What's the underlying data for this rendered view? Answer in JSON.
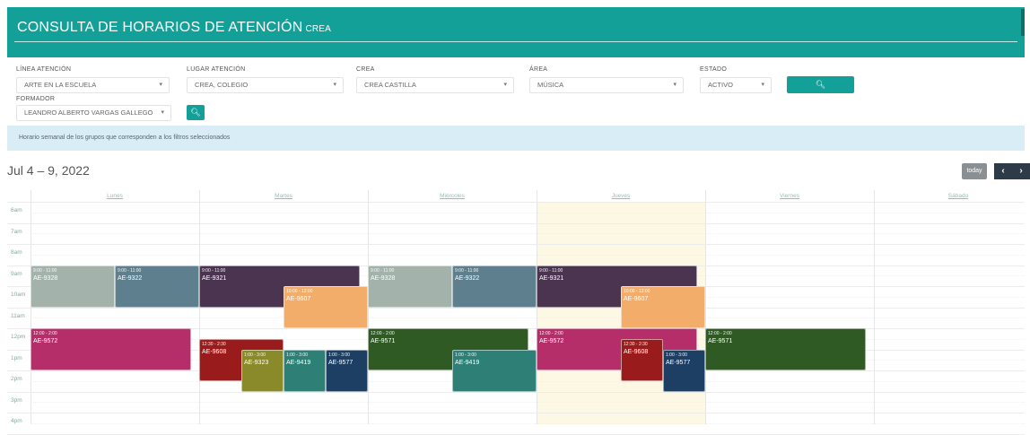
{
  "header": {
    "title": "CONSULTA DE HORARIOS DE ATENCIÓN",
    "suffix": "CREA"
  },
  "filters": {
    "linea": {
      "label": "LÍNEA ATENCIÓN",
      "value": "ARTE EN LA ESCUELA"
    },
    "lugar": {
      "label": "LUGAR ATENCIÓN",
      "value": "CREA, COLEGIO"
    },
    "crea": {
      "label": "CREA",
      "value": "CREA CASTILLA"
    },
    "area": {
      "label": "ÁREA",
      "value": "MÚSICA"
    },
    "estado": {
      "label": "ESTADO",
      "value": "ACTIVO"
    },
    "formador": {
      "label": "FORMADOR",
      "value": "LEANDRO ALBERTO VARGAS GALLEGO"
    },
    "search_icon": "search-icon"
  },
  "info_text": "Horario semanal de los grupos que corresponden a los filtros seleccionados",
  "calendar": {
    "date_range": "Jul 4 – 9, 2022",
    "today_label": "today",
    "prev_label": "‹",
    "next_label": "›",
    "days": [
      "Lunes",
      "Martes",
      "Miércoles",
      "Jueves",
      "Viernes",
      "Sábado"
    ],
    "times": [
      "6am",
      "7am",
      "8am",
      "9am",
      "10am",
      "11am",
      "12pm",
      "1pm",
      "2pm",
      "3pm",
      "4pm"
    ],
    "events": [
      {
        "day": 0,
        "start": 9,
        "end": 11,
        "lane": 0,
        "lanes": 2,
        "time": "9:00 - 11:00",
        "code": "AE-9328",
        "color": "#a3b3ac"
      },
      {
        "day": 0,
        "start": 9,
        "end": 11,
        "lane": 1,
        "lanes": 2,
        "time": "9:00 - 11:00",
        "code": "AE-9322",
        "color": "#5d7f8e"
      },
      {
        "day": 0,
        "start": 12,
        "end": 14,
        "lane": 0,
        "lanes": 1,
        "time": "12:00 - 2:00",
        "code": "AE-9572",
        "color": "#b52e69"
      },
      {
        "day": 1,
        "start": 9,
        "end": 11,
        "lane": 0,
        "lanes": 1,
        "time": "9:00 - 11:00",
        "code": "AE-9321",
        "color": "#4a3450"
      },
      {
        "day": 1,
        "start": 10,
        "end": 12,
        "lane": 1,
        "lanes": 2,
        "time": "10:00 - 12:00",
        "code": "AE-9607",
        "color": "#f2ad6a"
      },
      {
        "day": 1,
        "start": 12.5,
        "end": 14.5,
        "lane": 0,
        "lanes": 2,
        "time": "12:30 - 2:30",
        "code": "AE-9608",
        "color": "#9a1b1b"
      },
      {
        "day": 1,
        "start": 13,
        "end": 15,
        "lane": 1,
        "lanes": 4,
        "time": "1:00 - 3:00",
        "code": "AE-9323",
        "color": "#8a8a2b"
      },
      {
        "day": 1,
        "start": 13,
        "end": 15,
        "lane": 2,
        "lanes": 4,
        "time": "1:00 - 3:00",
        "code": "AE-9419",
        "color": "#2e8077"
      },
      {
        "day": 1,
        "start": 13,
        "end": 15,
        "lane": 3,
        "lanes": 4,
        "time": "1:00 - 3:00",
        "code": "AE-9577",
        "color": "#1d3f63"
      },
      {
        "day": 2,
        "start": 9,
        "end": 11,
        "lane": 0,
        "lanes": 2,
        "time": "9:00 - 11:00",
        "code": "AE-9328",
        "color": "#a3b3ac"
      },
      {
        "day": 2,
        "start": 9,
        "end": 11,
        "lane": 1,
        "lanes": 2,
        "time": "9:00 - 11:00",
        "code": "AE-9322",
        "color": "#5d7f8e"
      },
      {
        "day": 2,
        "start": 12,
        "end": 14,
        "lane": 0,
        "lanes": 1,
        "time": "12:00 - 2:00",
        "code": "AE-9571",
        "color": "#2f5a23"
      },
      {
        "day": 2,
        "start": 13,
        "end": 15,
        "lane": 1,
        "lanes": 2,
        "time": "1:00 - 3:00",
        "code": "AE-9419",
        "color": "#2e8077"
      },
      {
        "day": 3,
        "start": 9,
        "end": 11,
        "lane": 0,
        "lanes": 1,
        "time": "9:00 - 11:00",
        "code": "AE-9321",
        "color": "#4a3450"
      },
      {
        "day": 3,
        "start": 10,
        "end": 12,
        "lane": 1,
        "lanes": 2,
        "time": "10:00 - 12:00",
        "code": "AE-9607",
        "color": "#f2ad6a"
      },
      {
        "day": 3,
        "start": 12,
        "end": 14,
        "lane": 0,
        "lanes": 1,
        "time": "12:00 - 2:00",
        "code": "AE-9572",
        "color": "#b52e69"
      },
      {
        "day": 3,
        "start": 12.5,
        "end": 14.5,
        "lane": 2,
        "lanes": 4,
        "time": "12:30 - 2:30",
        "code": "AE-9608",
        "color": "#9a1b1b"
      },
      {
        "day": 3,
        "start": 13,
        "end": 15,
        "lane": 3,
        "lanes": 4,
        "time": "1:00 - 3:00",
        "code": "AE-9577",
        "color": "#1d3f63"
      },
      {
        "day": 4,
        "start": 12,
        "end": 14,
        "lane": 0,
        "lanes": 1,
        "time": "12:00 - 2:00",
        "code": "AE-9571",
        "color": "#2f5a23"
      }
    ]
  }
}
